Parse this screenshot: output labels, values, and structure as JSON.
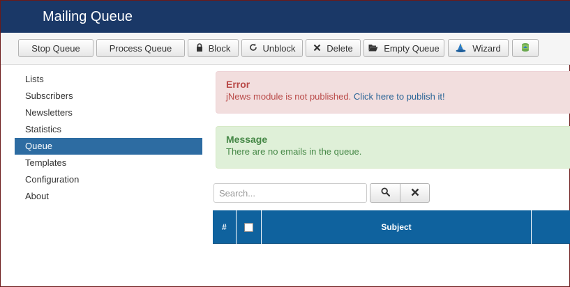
{
  "header": {
    "title": "Mailing Queue"
  },
  "toolbar": {
    "stop_queue": "Stop Queue",
    "process_queue": "Process Queue",
    "block": "Block",
    "unblock": "Unblock",
    "delete": "Delete",
    "empty_queue": "Empty Queue",
    "wizard": "Wizard"
  },
  "sidebar": {
    "items": [
      {
        "label": "Lists"
      },
      {
        "label": "Subscribers"
      },
      {
        "label": "Newsletters"
      },
      {
        "label": "Statistics"
      },
      {
        "label": "Queue"
      },
      {
        "label": "Templates"
      },
      {
        "label": "Configuration"
      },
      {
        "label": "About"
      }
    ],
    "active_index": 4
  },
  "alerts": {
    "error": {
      "heading": "Error",
      "message": "jNews module is not published.",
      "link": "Click here to publish it!"
    },
    "success": {
      "heading": "Message",
      "message": "There are no emails in the queue."
    }
  },
  "search": {
    "placeholder": "Search..."
  },
  "table": {
    "headers": {
      "num": "#",
      "subject": "Subject"
    }
  },
  "colors": {
    "header_bg": "#1a3867",
    "nav_active": "#2d6ca2",
    "table_head": "#0f629e",
    "error_bg": "#f2dede",
    "success_bg": "#dff0d8"
  }
}
